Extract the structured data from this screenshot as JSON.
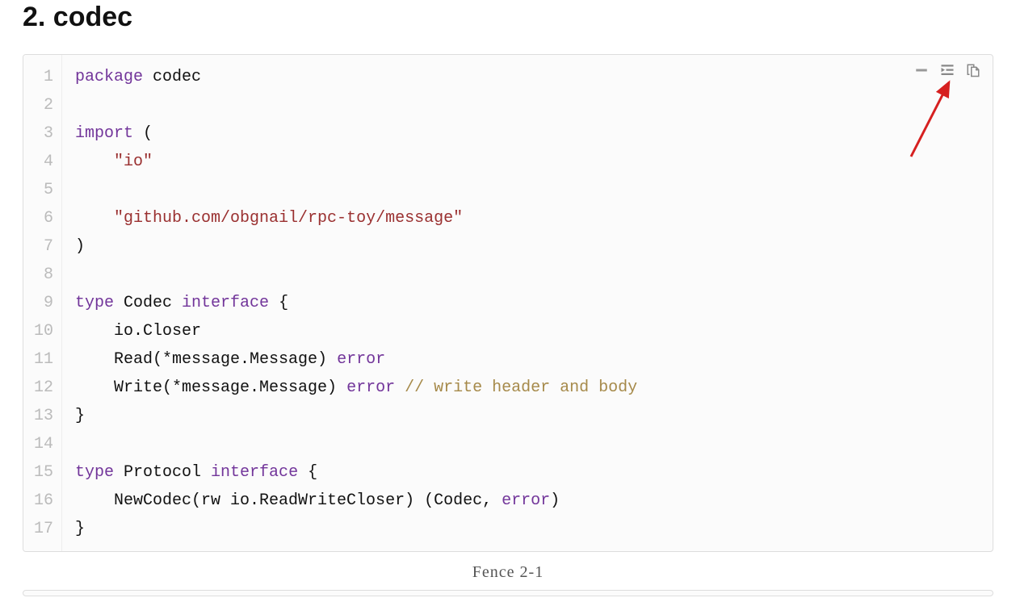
{
  "heading": "2. codec",
  "caption": "Fence 2-1",
  "code": {
    "line_count": 17,
    "lines": [
      {
        "n": 1,
        "tokens": [
          {
            "t": "package",
            "c": "kw"
          },
          {
            "t": " ",
            "c": "pln"
          },
          {
            "t": "codec",
            "c": "pln"
          }
        ]
      },
      {
        "n": 2,
        "tokens": []
      },
      {
        "n": 3,
        "tokens": [
          {
            "t": "import",
            "c": "kw"
          },
          {
            "t": " (",
            "c": "pln"
          }
        ]
      },
      {
        "n": 4,
        "tokens": [
          {
            "t": "    ",
            "c": "pln"
          },
          {
            "t": "\"io\"",
            "c": "str"
          }
        ]
      },
      {
        "n": 5,
        "tokens": []
      },
      {
        "n": 6,
        "tokens": [
          {
            "t": "    ",
            "c": "pln"
          },
          {
            "t": "\"github.com/obgnail/rpc-toy/message\"",
            "c": "str"
          }
        ]
      },
      {
        "n": 7,
        "tokens": [
          {
            "t": ")",
            "c": "pln"
          }
        ]
      },
      {
        "n": 8,
        "tokens": []
      },
      {
        "n": 9,
        "tokens": [
          {
            "t": "type",
            "c": "kw"
          },
          {
            "t": " Codec ",
            "c": "pln"
          },
          {
            "t": "interface",
            "c": "kw"
          },
          {
            "t": " {",
            "c": "pln"
          }
        ]
      },
      {
        "n": 10,
        "tokens": [
          {
            "t": "    io.Closer",
            "c": "pln"
          }
        ]
      },
      {
        "n": 11,
        "tokens": [
          {
            "t": "    Read(*message.Message) ",
            "c": "pln"
          },
          {
            "t": "error",
            "c": "kw"
          }
        ]
      },
      {
        "n": 12,
        "tokens": [
          {
            "t": "    Write(*message.Message) ",
            "c": "pln"
          },
          {
            "t": "error",
            "c": "kw"
          },
          {
            "t": " ",
            "c": "pln"
          },
          {
            "t": "// write header and body",
            "c": "com"
          }
        ]
      },
      {
        "n": 13,
        "tokens": [
          {
            "t": "}",
            "c": "pln"
          }
        ]
      },
      {
        "n": 14,
        "tokens": []
      },
      {
        "n": 15,
        "tokens": [
          {
            "t": "type",
            "c": "kw"
          },
          {
            "t": " Protocol ",
            "c": "pln"
          },
          {
            "t": "interface",
            "c": "kw"
          },
          {
            "t": " {",
            "c": "pln"
          }
        ]
      },
      {
        "n": 16,
        "tokens": [
          {
            "t": "    NewCodec(rw io.ReadWriteCloser) (Codec, ",
            "c": "pln"
          },
          {
            "t": "error",
            "c": "kw"
          },
          {
            "t": ")",
            "c": "pln"
          }
        ]
      },
      {
        "n": 17,
        "tokens": [
          {
            "t": "}",
            "c": "pln"
          }
        ]
      }
    ]
  },
  "toolbar": {
    "collapse": "Collapse",
    "wrap": "Toggle wrap",
    "copy": "Copy"
  }
}
